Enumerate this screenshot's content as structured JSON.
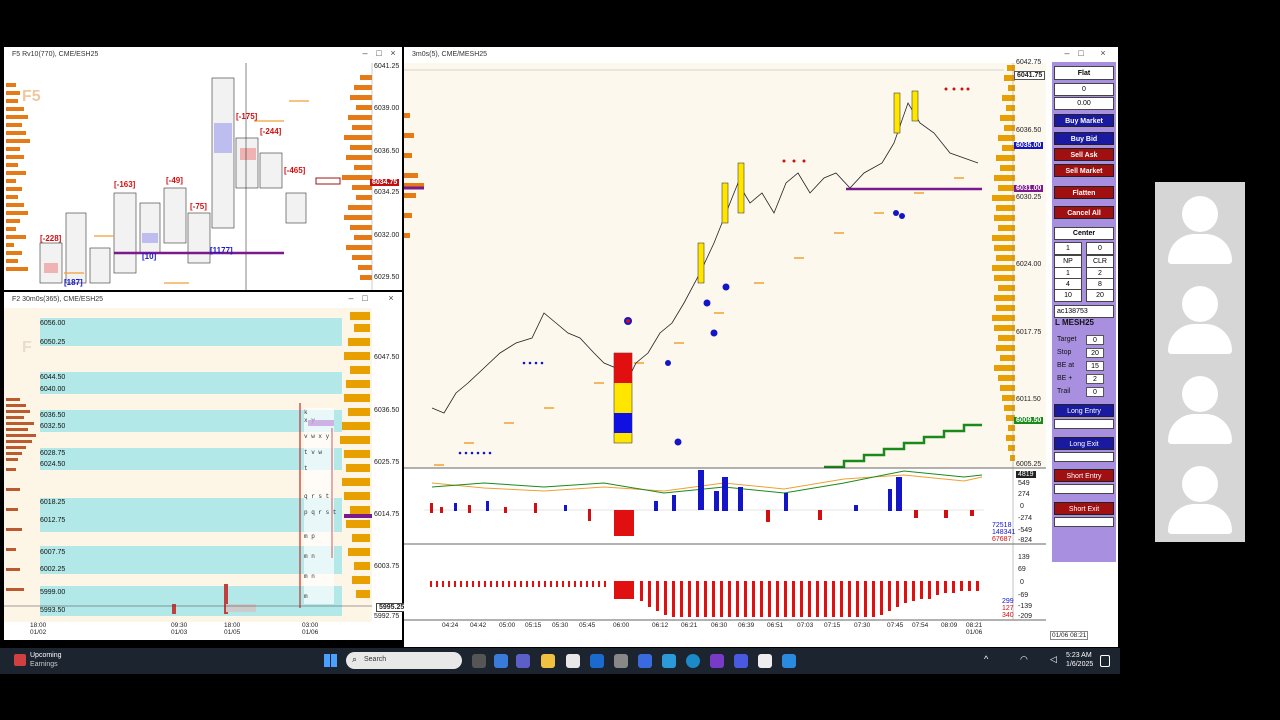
{
  "windows": {
    "f5": {
      "title": "F5 Rv10(770), CME/ESH25",
      "watermark": "F5",
      "price_labels": [
        "6041.25",
        "6039.00",
        "6036.50",
        "6034.25",
        "6032.00",
        "6029.50"
      ],
      "current_price": "6034.75",
      "delta_labels": [
        "[-228]",
        "[187]",
        "[-163]",
        "[10]",
        "[-49]",
        "[-75]",
        "[1177]",
        "[-175]",
        "[-244]",
        "[-465]"
      ]
    },
    "f2": {
      "title": "F2 30m0s(365), CME/ESH25",
      "watermark": "F",
      "price_labels": [
        "6047.50",
        "6036.50",
        "6025.75",
        "6014.75",
        "6003.75",
        "5992.75"
      ],
      "current_price": "5995.25",
      "level_labels": [
        "6056.00",
        "6050.25",
        "6044.50",
        "6040.00",
        "6036.50",
        "6032.50",
        "6028.75",
        "6024.50",
        "6018.25",
        "6012.75",
        "6007.75",
        "6002.25",
        "5999.00",
        "5993.50"
      ],
      "time_labels": [
        {
          "t": "18:00",
          "d": "01/02"
        },
        {
          "t": "09:30",
          "d": "01/03"
        },
        {
          "t": "18:00",
          "d": "01/05"
        },
        {
          "t": "03:00",
          "d": "01/06"
        }
      ]
    },
    "main": {
      "title": "3m0s(5), CME/MESH25",
      "price_labels": [
        "6042.75",
        "6036.50",
        "6030.25",
        "6024.00",
        "6017.75",
        "6011.50",
        "6005.25"
      ],
      "tag_top": "6041.75",
      "tag_current": "6035.00",
      "tag_mid": "6031.00",
      "tag_green": "6009.50",
      "osc1_labels": [
        "4819",
        "549",
        "274",
        "0",
        "-274",
        "-549",
        "-824"
      ],
      "osc1_values": [
        "72518",
        "148341",
        "67687"
      ],
      "osc2_labels": [
        "139",
        "69",
        "0",
        "-69",
        "-139",
        "-209"
      ],
      "osc2_values": [
        "299",
        "127",
        "340"
      ],
      "time_labels": [
        "04:24",
        "04:42",
        "05:00",
        "05:15",
        "05:30",
        "05:45",
        "06:00",
        "06:12",
        "06:21",
        "06:30",
        "06:39",
        "06:51",
        "07:03",
        "07:15",
        "07:30",
        "07:45",
        "07:54",
        "08:09",
        "08:21"
      ],
      "date_label": "01/06",
      "footer_time": "01/06 08:21"
    }
  },
  "panel": {
    "status": "Flat",
    "position": "0",
    "pnl": "0.00",
    "buy_market": "Buy Market",
    "buy_bid": "Buy Bid",
    "sell_ask": "Sell Ask",
    "sell_market": "Sell Market",
    "flatten": "Flatten",
    "cancel_all": "Cancel All",
    "center": "Center",
    "qty": "1",
    "qty2": "0",
    "np": "NP",
    "clr": "CLR",
    "grid": [
      "1",
      "2",
      "4",
      "8",
      "10",
      "20"
    ],
    "account": "ac138753",
    "instrument": "L MESH25",
    "target_label": "Target",
    "target_val": "0",
    "stop_label": "Stop",
    "stop_val": "20",
    "beat_label": "BE at",
    "beat_val": "15",
    "beplus_label": "BE +",
    "beplus_val": "2",
    "trail_label": "Trail",
    "trail_val": "0",
    "long_entry": "Long Entry",
    "long_exit": "Long Exit",
    "short_entry": "Short Entry",
    "short_exit": "Short Exit"
  },
  "taskbar": {
    "weather_title": "Upcoming",
    "weather_sub": "Earnings",
    "search": "Search",
    "time": "5:23 AM",
    "date": "1/6/2025"
  },
  "colors": {
    "panel": "#a98fe0",
    "buy": "#1a1aa0",
    "sell": "#a01010",
    "taskbar": "#1c2430",
    "chart_bg": "#fdf8ee"
  }
}
